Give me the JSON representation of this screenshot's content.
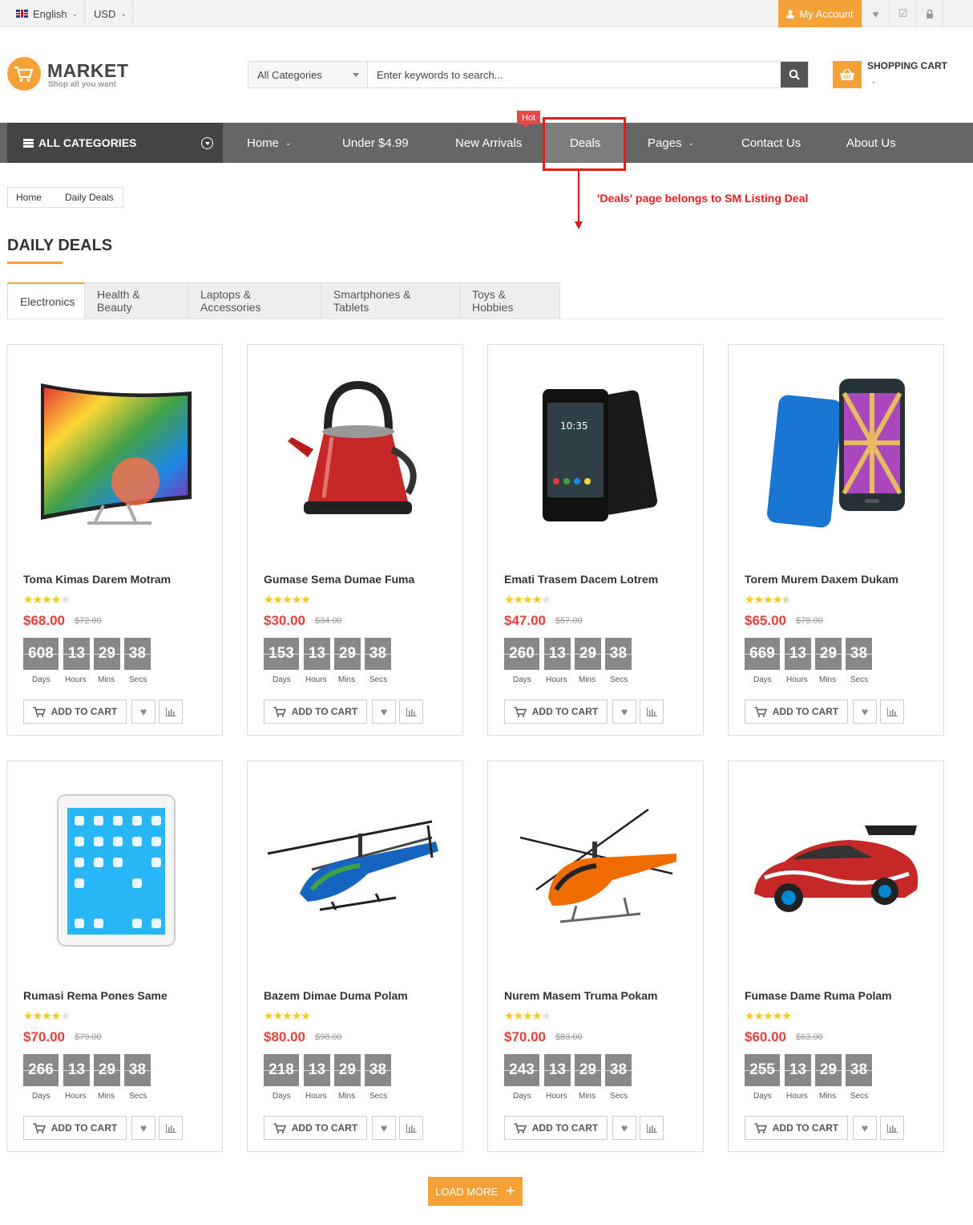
{
  "topbar": {
    "language": "English",
    "currency": "USD",
    "my_account": "My Account"
  },
  "logo": {
    "name": "MARKET",
    "tagline": "Shop all you want"
  },
  "search": {
    "category": "All Categories",
    "placeholder": "Enter keywords to search..."
  },
  "cart": {
    "title": "SHOPPING CART",
    "summary": "-"
  },
  "nav": {
    "all_categories": "ALL CATEGORIES",
    "items": [
      "Home",
      "Under $4.99",
      "New Arrivals",
      "Deals",
      "Pages",
      "Contact Us",
      "About Us"
    ],
    "hot_badge": "Hot"
  },
  "annotation": "'Deals' page belongs to SM Listing Deal",
  "breadcrumb": [
    "Home",
    "Daily Deals"
  ],
  "page_title": "DAILY DEALS",
  "tabs": [
    "Electronics",
    "Health & Beauty",
    "Laptops & Accessories",
    "Smartphones & Tablets",
    "Toys & Hobbies"
  ],
  "countdown_labels": {
    "days": "Days",
    "hours": "Hours",
    "mins": "Mins",
    "secs": "Secs"
  },
  "buttons": {
    "add_to_cart": "ADD TO CART",
    "load_more": "LOAD MORE"
  },
  "products": [
    {
      "name": "Toma Kimas Darem Motram",
      "price": "$68.00",
      "old_price": "$72.00",
      "rating": 4,
      "days": "608",
      "hours": "13",
      "mins": "29",
      "secs": "38",
      "image": "curved-tv"
    },
    {
      "name": "Gumase Sema Dumae Fuma",
      "price": "$30.00",
      "old_price": "$34.00",
      "rating": 5,
      "days": "153",
      "hours": "13",
      "mins": "29",
      "secs": "38",
      "image": "red-kettle"
    },
    {
      "name": "Emati Trasem Dacem Lotrem",
      "price": "$47.00",
      "old_price": "$57.00",
      "rating": 4,
      "days": "260",
      "hours": "13",
      "mins": "29",
      "secs": "38",
      "image": "black-phone"
    },
    {
      "name": "Torem Murem Daxem Dukam",
      "price": "$65.00",
      "old_price": "$78.00",
      "rating": 4.5,
      "days": "669",
      "hours": "13",
      "mins": "29",
      "secs": "38",
      "image": "blue-phone"
    },
    {
      "name": "Rumasi Rema Pones Same",
      "price": "$70.00",
      "old_price": "$79.00",
      "rating": 4,
      "days": "266",
      "hours": "13",
      "mins": "29",
      "secs": "38",
      "image": "tablet"
    },
    {
      "name": "Bazem Dimae Duma Polam",
      "price": "$80.00",
      "old_price": "$98.00",
      "rating": 5,
      "days": "218",
      "hours": "13",
      "mins": "29",
      "secs": "38",
      "image": "blue-helicopter"
    },
    {
      "name": "Nurem Masem Truma Pokam",
      "price": "$70.00",
      "old_price": "$83.00",
      "rating": 4,
      "days": "243",
      "hours": "13",
      "mins": "29",
      "secs": "38",
      "image": "orange-helicopter"
    },
    {
      "name": "Fumase Dame Ruma Polam",
      "price": "$60.00",
      "old_price": "$63.00",
      "rating": 5,
      "days": "255",
      "hours": "13",
      "mins": "29",
      "secs": "38",
      "image": "race-car"
    }
  ],
  "colors": {
    "accent": "#f4a137",
    "price": "#e2413b",
    "nav": "#666666",
    "annotation": "#e51c1c"
  }
}
